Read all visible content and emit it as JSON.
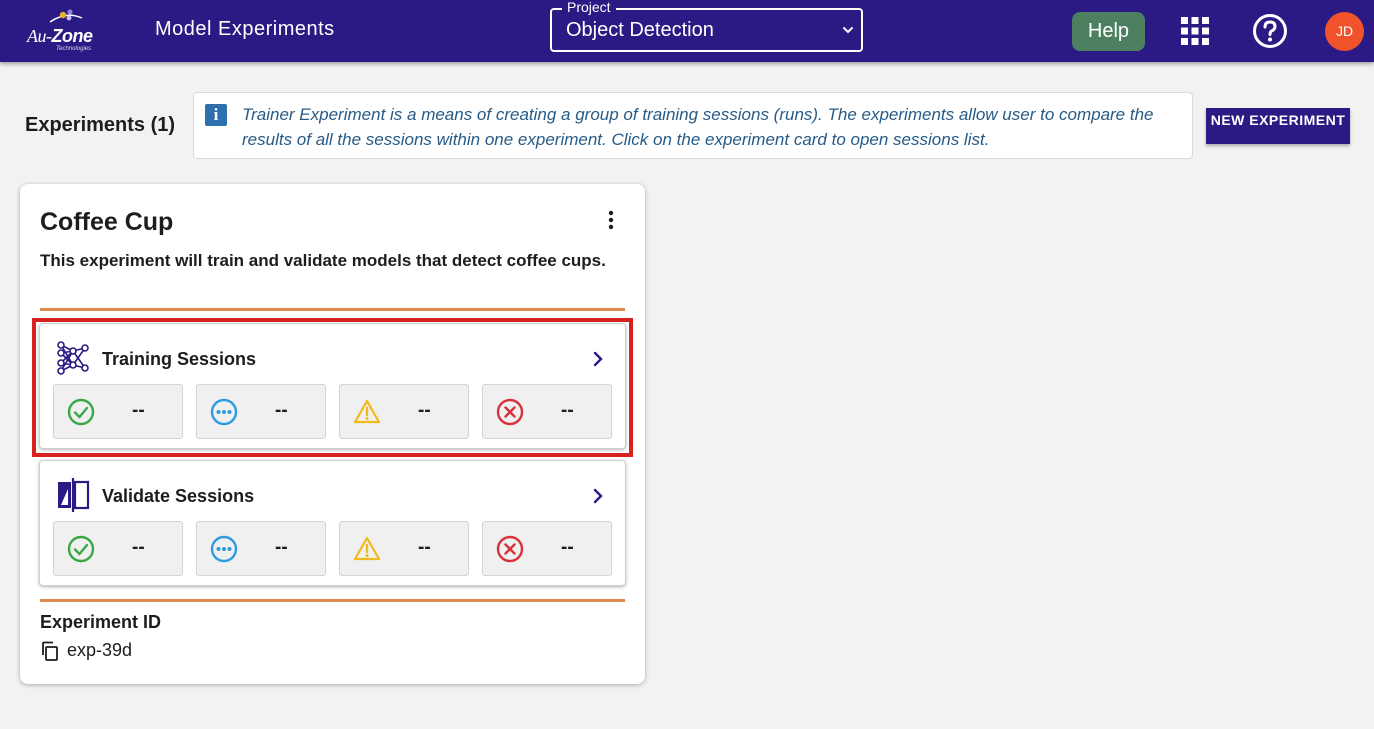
{
  "header": {
    "logo": {
      "brand_prefix": "Au-",
      "brand_main": "Zone",
      "tagline": "Technologies"
    },
    "title": "Model Experiments",
    "project_select": {
      "label": "Project",
      "value": "Object Detection"
    },
    "help_label": "Help",
    "avatar_initials": "JD",
    "colors": {
      "bar": "#2b1a84",
      "help_button": "#4d8060",
      "avatar": "#f0522c"
    },
    "icons": [
      "apps-grid-icon",
      "help-circle-icon"
    ]
  },
  "experiments": {
    "heading": "Experiments (1)",
    "info_text": "Trainer Experiment is a means of creating a group of training sessions (runs). The experiments allow user to compare the results of all the sessions within one experiment. Click on the experiment card to open sessions list.",
    "new_button_label": "NEW EXPERIMENT"
  },
  "card": {
    "title": "Coffee Cup",
    "description": "This experiment will train and validate models that detect coffee cups.",
    "training": {
      "label": "Training Sessions",
      "icon": "neural-network-icon",
      "stats": {
        "complete": "--",
        "running": "--",
        "warning": "--",
        "error": "--"
      }
    },
    "validate": {
      "label": "Validate Sessions",
      "icon": "validate-compare-icon",
      "stats": {
        "complete": "--",
        "running": "--",
        "warning": "--",
        "error": "--"
      }
    },
    "experiment_id_label": "Experiment ID",
    "experiment_id_value": "exp-39d",
    "colors": {
      "rule": "#e0894c",
      "highlight": "#d9221f",
      "complete": "#3aa845",
      "running": "#2e9be0",
      "warning": "#f2b91d",
      "error": "#d9303a"
    }
  }
}
